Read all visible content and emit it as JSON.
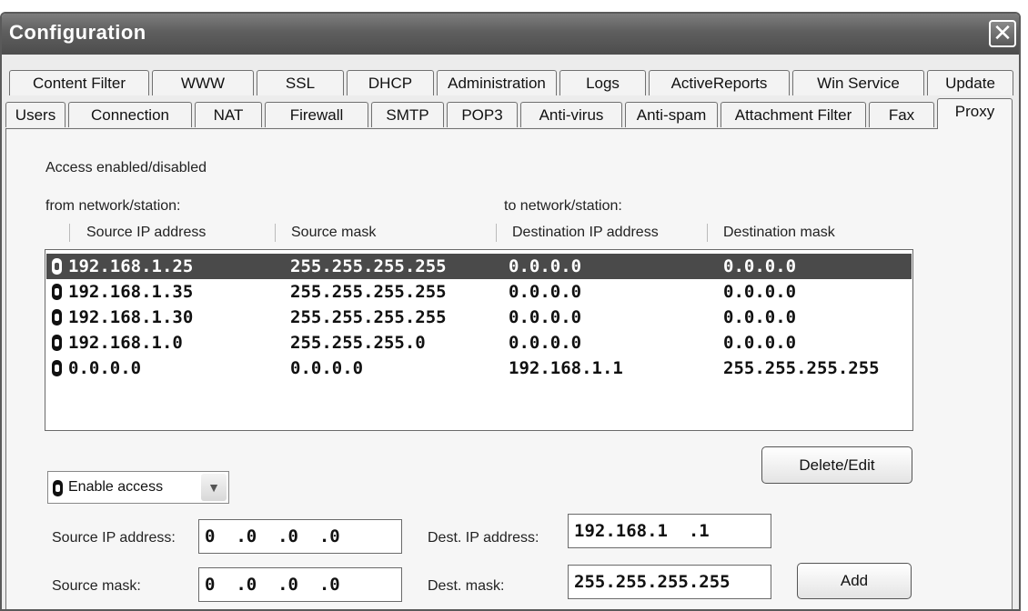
{
  "window": {
    "title": "Configuration",
    "close_glyph": "✕"
  },
  "tabs_row1": [
    "Content Filter",
    "WWW",
    "SSL",
    "DHCP",
    "Administration",
    "Logs",
    "ActiveReports",
    "Win Service",
    "Update"
  ],
  "tabs_row2": [
    "Users",
    "Connection",
    "NAT",
    "Firewall",
    "SMTP",
    "POP3",
    "Anti-virus",
    "Anti-spam",
    "Attachment Filter",
    "Fax",
    "Proxy"
  ],
  "active_tab": "Proxy",
  "panel": {
    "section_label": "Access enabled/disabled",
    "from_label": "from network/station:",
    "to_label": "to network/station:"
  },
  "table": {
    "columns": [
      "Source IP address",
      "Source mask",
      "Destination IP address",
      "Destination mask"
    ],
    "rows": [
      {
        "src": "192.168.1.25",
        "mask": "255.255.255.255",
        "dst": "0.0.0.0",
        "dmask": "0.0.0.0",
        "selected": true
      },
      {
        "src": "192.168.1.35",
        "mask": "255.255.255.255",
        "dst": "0.0.0.0",
        "dmask": "0.0.0.0",
        "selected": false
      },
      {
        "src": "192.168.1.30",
        "mask": "255.255.255.255",
        "dst": "0.0.0.0",
        "dmask": "0.0.0.0",
        "selected": false
      },
      {
        "src": "192.168.1.0",
        "mask": "255.255.255.0",
        "dst": "0.0.0.0",
        "dmask": "0.0.0.0",
        "selected": false
      },
      {
        "src": "0.0.0.0",
        "mask": "0.0.0.0",
        "dst": "192.168.1.1",
        "dmask": "255.255.255.255",
        "selected": false
      }
    ]
  },
  "buttons": {
    "delete_edit": "Delete/Edit",
    "add": "Add"
  },
  "access_select": {
    "value": "Enable access"
  },
  "form": {
    "source_ip_label": "Source IP address:",
    "source_ip_value": "0  .0  .0  .0",
    "source_mask_label": "Source mask:",
    "source_mask_value": "0  .0  .0  .0",
    "dest_ip_label": "Dest. IP address:",
    "dest_ip_value": "192.168.1  .1",
    "dest_mask_label": "Dest. mask:",
    "dest_mask_value": "255.255.255.255"
  },
  "icons": {
    "lock": "lock-icon",
    "dropdown": "chevron-down-icon",
    "close": "close-icon"
  },
  "colors": {
    "titlebar": "#5e5e5e",
    "selection": "#4a4a4a",
    "window_bg": "#ececec"
  }
}
